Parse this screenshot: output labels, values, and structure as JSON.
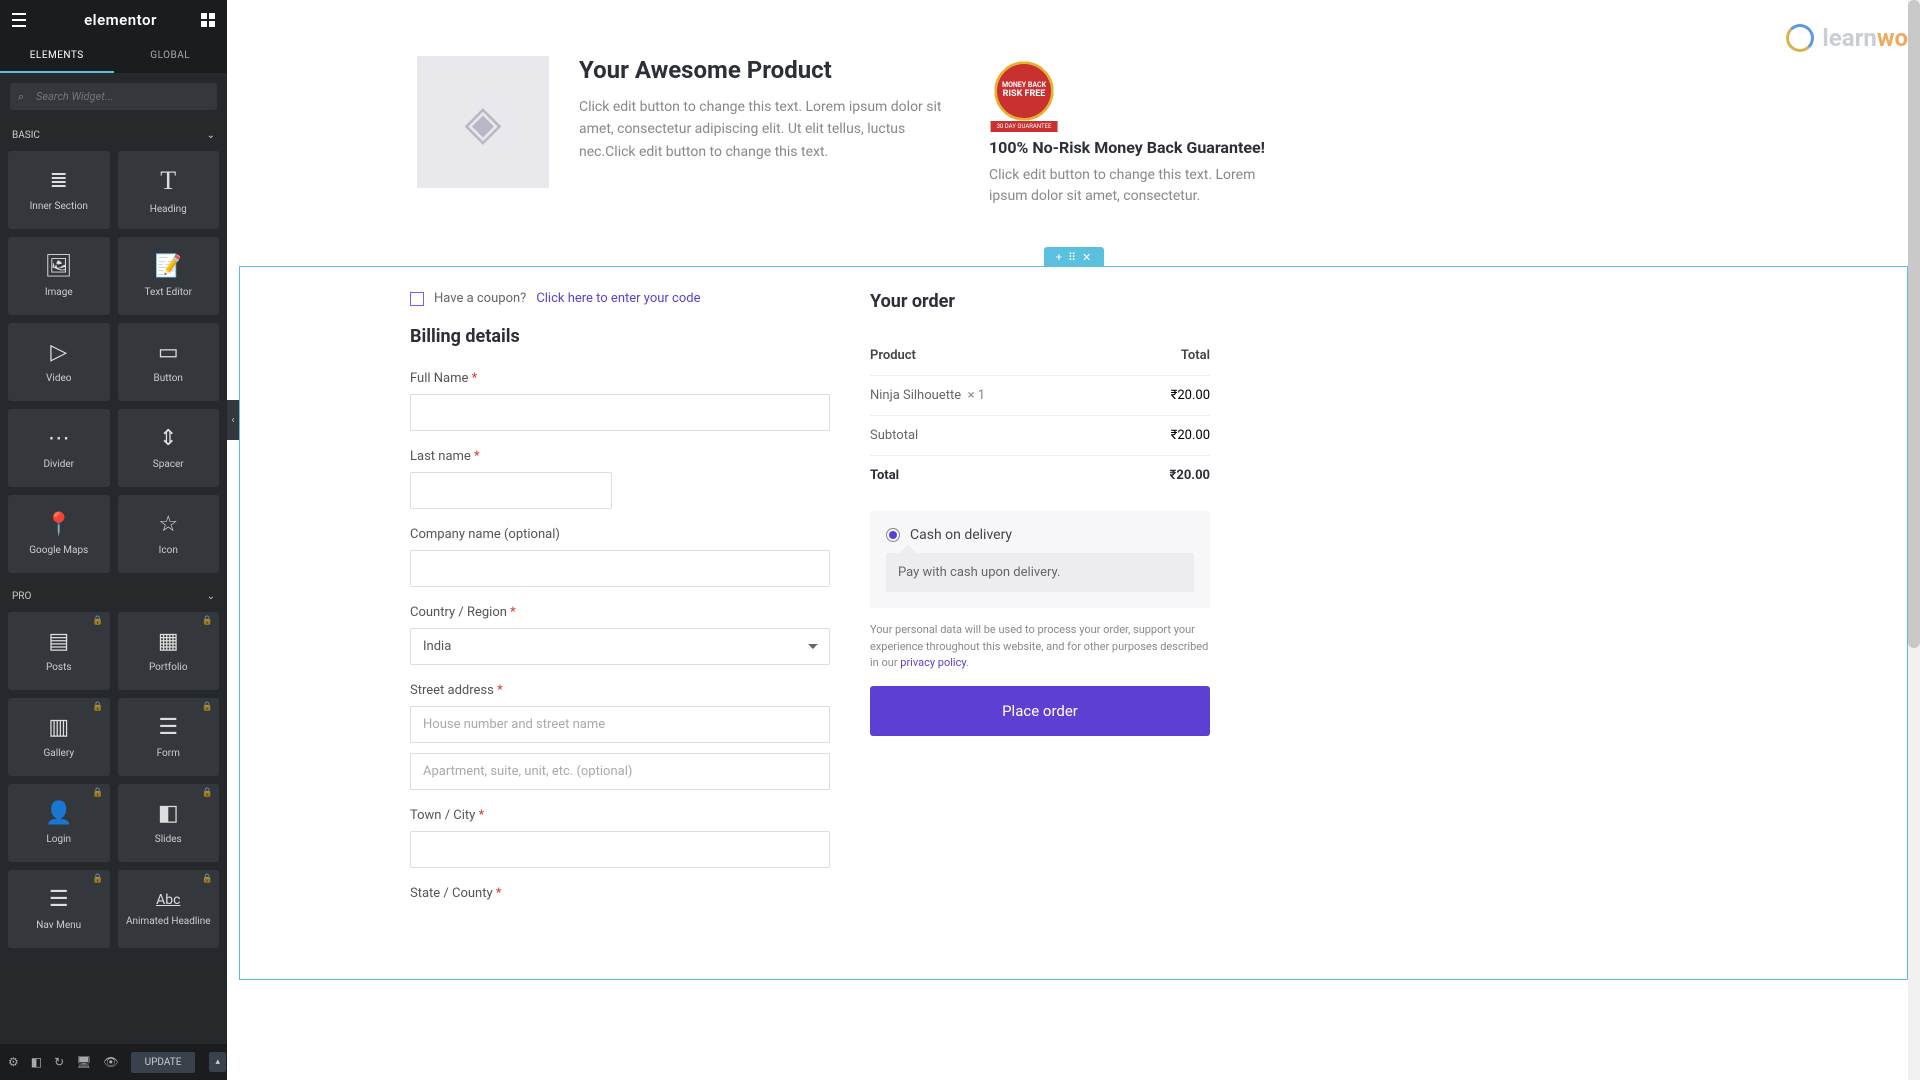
{
  "sidebar": {
    "logo": "elementor",
    "tabs": {
      "elements": "ELEMENTS",
      "global": "GLOBAL"
    },
    "search_placeholder": "Search Widget...",
    "categories": {
      "basic": "BASIC",
      "pro": "PRO"
    },
    "widgets_basic": [
      {
        "label": "Inner Section"
      },
      {
        "label": "Heading"
      },
      {
        "label": "Image"
      },
      {
        "label": "Text Editor"
      },
      {
        "label": "Video"
      },
      {
        "label": "Button"
      },
      {
        "label": "Divider"
      },
      {
        "label": "Spacer"
      },
      {
        "label": "Google Maps"
      },
      {
        "label": "Icon"
      }
    ],
    "widgets_pro": [
      {
        "label": "Posts"
      },
      {
        "label": "Portfolio"
      },
      {
        "label": "Gallery"
      },
      {
        "label": "Form"
      },
      {
        "label": "Login"
      },
      {
        "label": "Slides"
      },
      {
        "label": "Nav Menu"
      },
      {
        "label": "Animated Headline"
      }
    ],
    "update_btn": "UPDATE"
  },
  "watermark": {
    "text_1": "learn",
    "text_2": "wo"
  },
  "hero": {
    "title": "Your Awesome Product",
    "desc": "Click edit button to change this text. Lorem ipsum dolor sit amet, consectetur adipiscing elit. Ut elit tellus, luctus nec.Click edit button to change this text.",
    "badge_top": "MONEY BACK",
    "badge_mid": "RISK FREE",
    "badge_ribbon": "30 DAY GUARANTEE",
    "guarantee_title": "100% No-Risk Money Back Guarantee!",
    "guarantee_desc": "Click edit button to change this text. Lorem ipsum dolor sit amet, consectetur."
  },
  "checkout": {
    "coupon_q": "Have a coupon?",
    "coupon_link": "Click here to enter your code",
    "billing_title": "Billing details",
    "fields": {
      "full_name": "Full Name",
      "last_name": "Last name",
      "company": "Company name (optional)",
      "country": "Country / Region",
      "country_value": "India",
      "street": "Street address",
      "street_ph1": "House number and street name",
      "street_ph2": "Apartment, suite, unit, etc. (optional)",
      "town": "Town / City",
      "state": "State / County"
    },
    "order": {
      "title": "Your order",
      "col_product": "Product",
      "col_total": "Total",
      "item_name": "Ninja Silhouette",
      "item_qty": "× 1",
      "item_price": "₹20.00",
      "subtotal_label": "Subtotal",
      "subtotal_value": "₹20.00",
      "total_label": "Total",
      "total_value": "₹20.00"
    },
    "payment": {
      "option": "Cash on delivery",
      "desc": "Pay with cash upon delivery."
    },
    "privacy": {
      "text": "Your personal data will be used to process your order, support your experience throughout this website, and for other purposes described in our ",
      "link": "privacy policy"
    },
    "place_order": "Place order"
  }
}
